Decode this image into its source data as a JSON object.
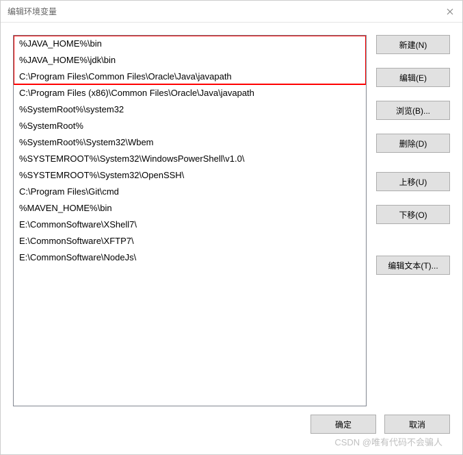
{
  "window": {
    "title": "编辑环境变量"
  },
  "list": {
    "items": [
      "%JAVA_HOME%\\bin",
      "%JAVA_HOME%\\jdk\\bin",
      "C:\\Program Files\\Common Files\\Oracle\\Java\\javapath",
      "C:\\Program Files (x86)\\Common Files\\Oracle\\Java\\javapath",
      "%SystemRoot%\\system32",
      "%SystemRoot%",
      "%SystemRoot%\\System32\\Wbem",
      "%SYSTEMROOT%\\System32\\WindowsPowerShell\\v1.0\\",
      "%SYSTEMROOT%\\System32\\OpenSSH\\",
      "C:\\Program Files\\Git\\cmd",
      "%MAVEN_HOME%\\bin",
      "E:\\CommonSoftware\\XShell7\\",
      "E:\\CommonSoftware\\XFTP7\\",
      "E:\\CommonSoftware\\NodeJs\\"
    ],
    "highlighted_count": 3
  },
  "buttons": {
    "new": "新建(N)",
    "edit": "编辑(E)",
    "browse": "浏览(B)...",
    "delete": "删除(D)",
    "move_up": "上移(U)",
    "move_down": "下移(O)",
    "edit_text": "编辑文本(T)...",
    "ok": "确定",
    "cancel": "取消"
  },
  "watermark": "CSDN @唯有代码不会骗人"
}
